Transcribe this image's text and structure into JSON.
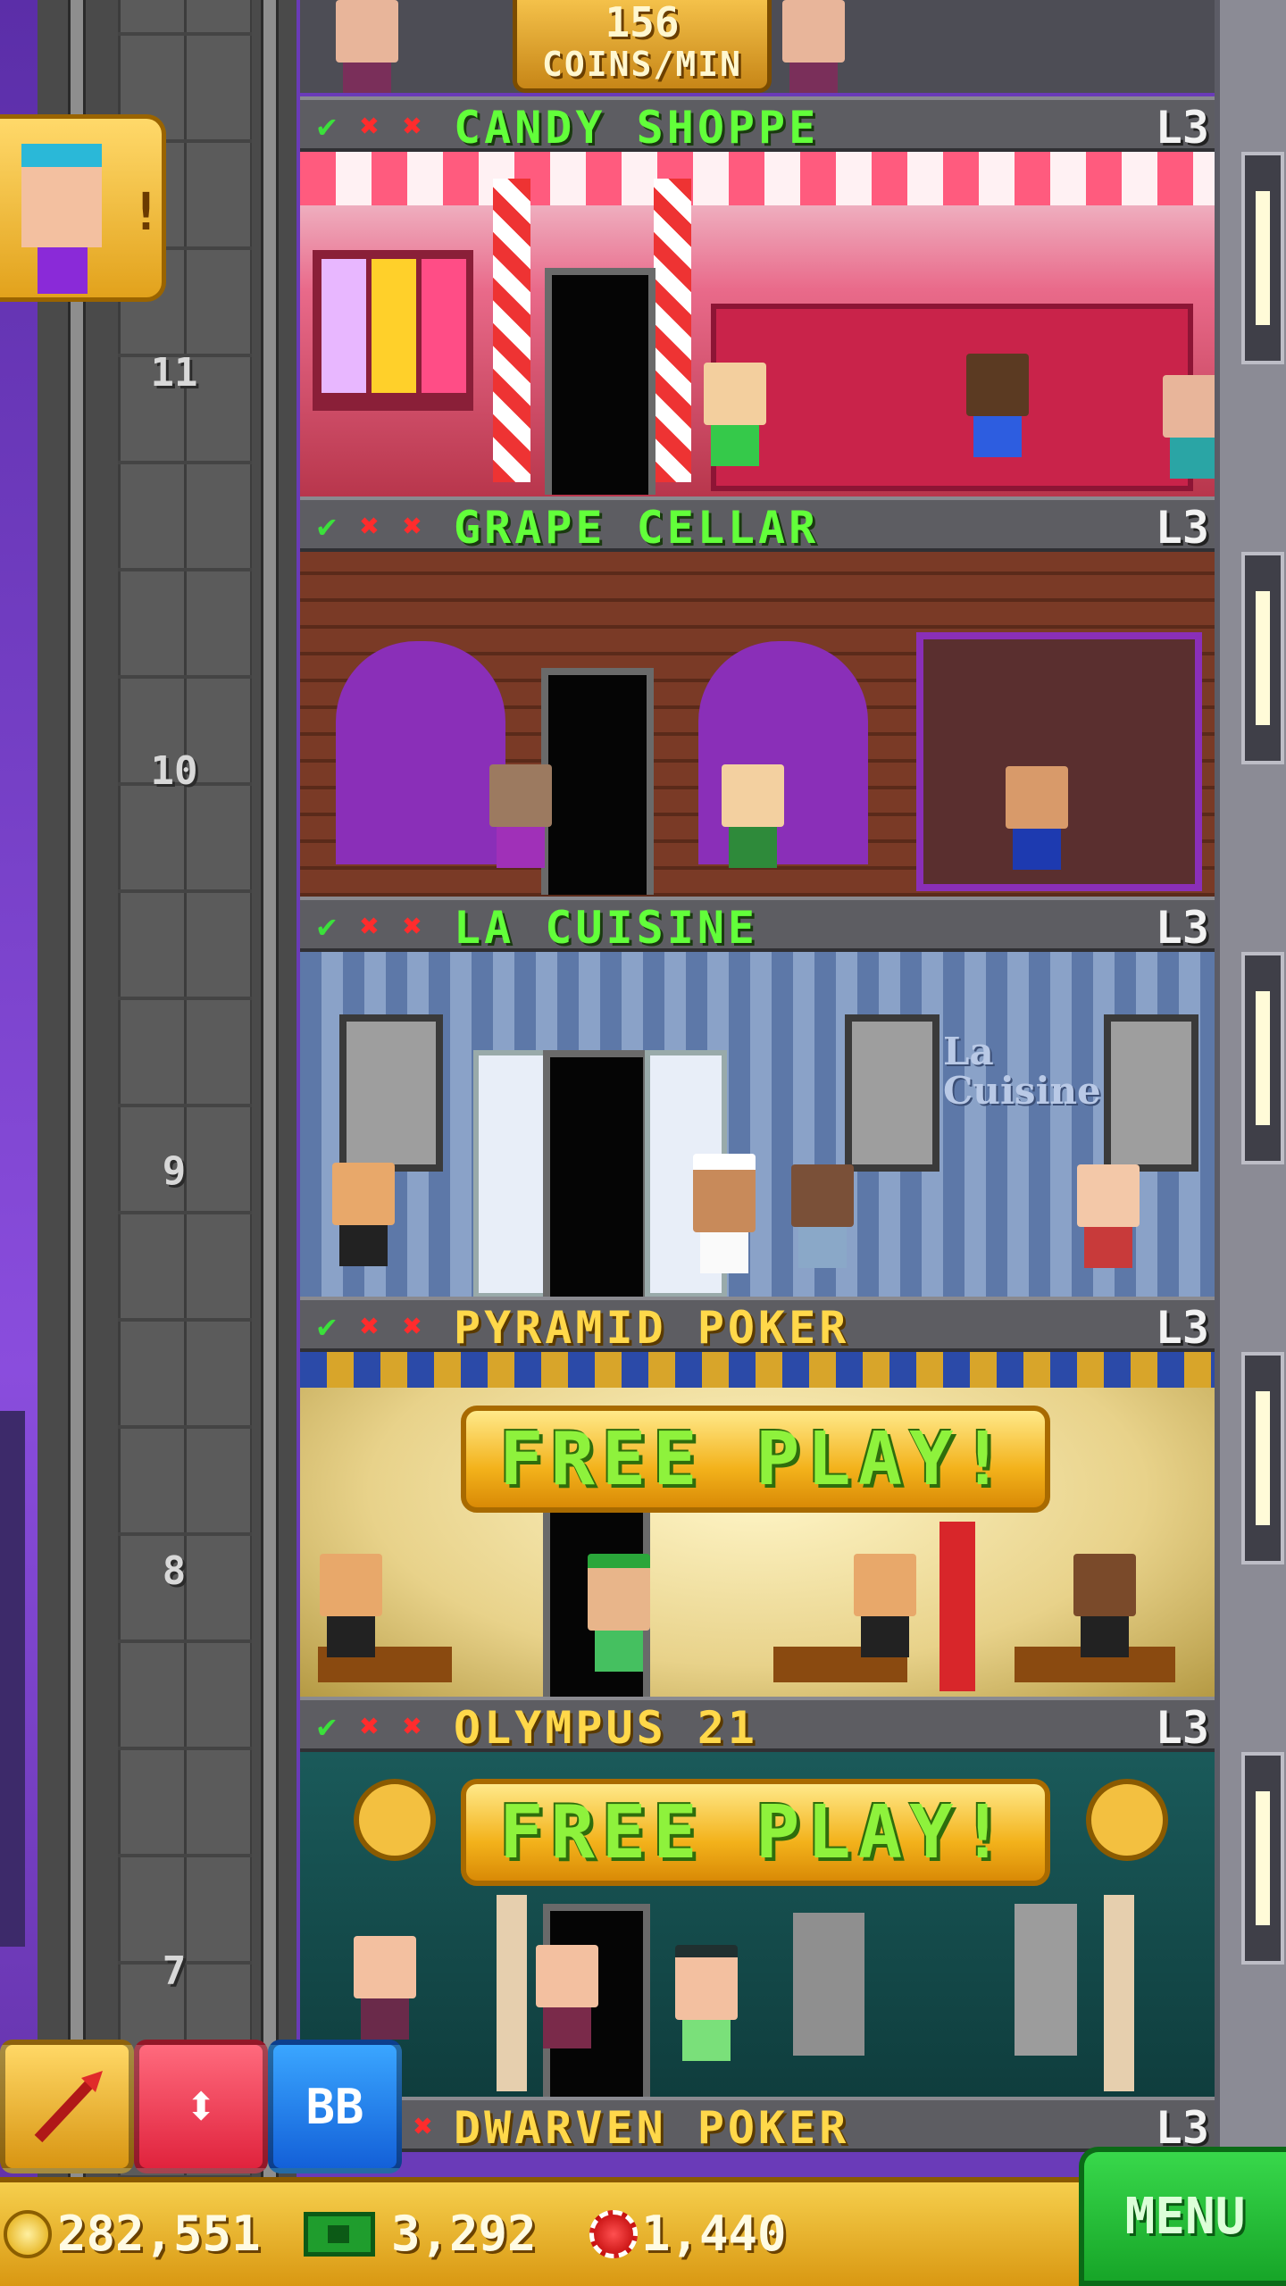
{
  "rate": {
    "value": "156",
    "unit": "COINS/MIN"
  },
  "shaft_floors": [
    "11",
    "10",
    "9",
    "8",
    "7"
  ],
  "floors": [
    {
      "name": "CANDY SHOPPE",
      "level": "L3",
      "stock": [
        "✔",
        "✖",
        "✖"
      ],
      "color": "#62ff3a"
    },
    {
      "name": "GRAPE CELLAR",
      "level": "L3",
      "stock": [
        "✔",
        "✖",
        "✖"
      ],
      "color": "#62ff3a"
    },
    {
      "name": "LA CUISINE",
      "level": "L3",
      "stock": [
        "✔",
        "✖",
        "✖"
      ],
      "color": "#62ff3a"
    },
    {
      "name": "PYRAMID POKER",
      "level": "L3",
      "stock": [
        "✔",
        "✖",
        "✖"
      ],
      "color": "#ffd84a"
    },
    {
      "name": "OLYMPUS 21",
      "level": "L3",
      "stock": [
        "✔",
        "✖",
        "✖"
      ],
      "color": "#ffd84a"
    },
    {
      "name": "DWARVEN POKER",
      "level": "L3",
      "stock": [
        "✖"
      ],
      "color": "#ffd84a"
    }
  ],
  "room_signs": {
    "la_cuisine": "La Cuisine"
  },
  "free_play": {
    "label": "FREE  PLAY!"
  },
  "visitor": {
    "alert": "!"
  },
  "tools": {
    "elevator_symbol": "⬍",
    "bitbook": "BB"
  },
  "currency": {
    "coins": "282,551",
    "bux": "3,292",
    "chips": "1,440"
  },
  "menu": {
    "label": "MENU"
  },
  "icons": [
    "rocket-icon",
    "elevator-arrows-icon",
    "bitbook-icon",
    "coin-icon",
    "bux-icon",
    "chip-icon",
    "check-icon",
    "cross-icon"
  ]
}
